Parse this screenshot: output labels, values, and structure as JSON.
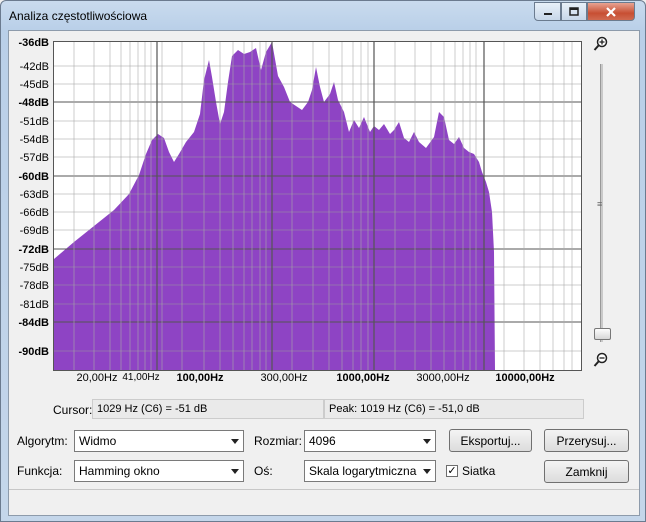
{
  "window": {
    "title": "Analiza częstotliwościowa"
  },
  "graph": {
    "y_labels": [
      {
        "text": "-36dB",
        "bold": true
      },
      {
        "text": "-42dB",
        "bold": false
      },
      {
        "text": "-45dB",
        "bold": false
      },
      {
        "text": "-48dB",
        "bold": true
      },
      {
        "text": "-51dB",
        "bold": false
      },
      {
        "text": "-54dB",
        "bold": false
      },
      {
        "text": "-57dB",
        "bold": false
      },
      {
        "text": "-60dB",
        "bold": true
      },
      {
        "text": "-63dB",
        "bold": false
      },
      {
        "text": "-66dB",
        "bold": false
      },
      {
        "text": "-69dB",
        "bold": false
      },
      {
        "text": "-72dB",
        "bold": true
      },
      {
        "text": "-75dB",
        "bold": false
      },
      {
        "text": "-78dB",
        "bold": false
      },
      {
        "text": "-81dB",
        "bold": false
      },
      {
        "text": "-84dB",
        "bold": true
      },
      {
        "text": "-90dB",
        "bold": true
      }
    ],
    "x_labels": [
      {
        "text": "20,00Hz",
        "bold": false
      },
      {
        "text": "41,00Hz",
        "bold": false
      },
      {
        "text": "100,00Hz",
        "bold": true
      },
      {
        "text": "300,00Hz",
        "bold": false
      },
      {
        "text": "1000,00Hz",
        "bold": true
      },
      {
        "text": "3000,00Hz",
        "bold": false
      },
      {
        "text": "10000,00Hz",
        "bold": true
      }
    ],
    "fill_color": "#8e44c4",
    "grid": true
  },
  "info": {
    "cursor_label": "Cursor:",
    "cursor_value": "1029 Hz (C6) = -51 dB",
    "peak_label": "Peak:",
    "peak_value": "1019 Hz (C6) = -51,0 dB"
  },
  "controls": {
    "algorithm_label": "Algorytm:",
    "algorithm_value": "Widmo",
    "size_label": "Rozmiar:",
    "size_value": "4096",
    "export_label": "Eksportuj...",
    "replot_label": "Przerysuj...",
    "function_label": "Funkcja:",
    "function_value": "Hamming okno",
    "axis_label": "Oś:",
    "axis_value": "Skala logarytmiczna",
    "grid_label": "Siatka",
    "grid_checked": true,
    "close_label": "Zamknij"
  },
  "icons": {
    "zoom_in": "zoom-in-icon",
    "zoom_out": "zoom-out-icon",
    "minimize": "minimize-icon",
    "maximize": "maximize-icon",
    "close": "close-icon"
  }
}
